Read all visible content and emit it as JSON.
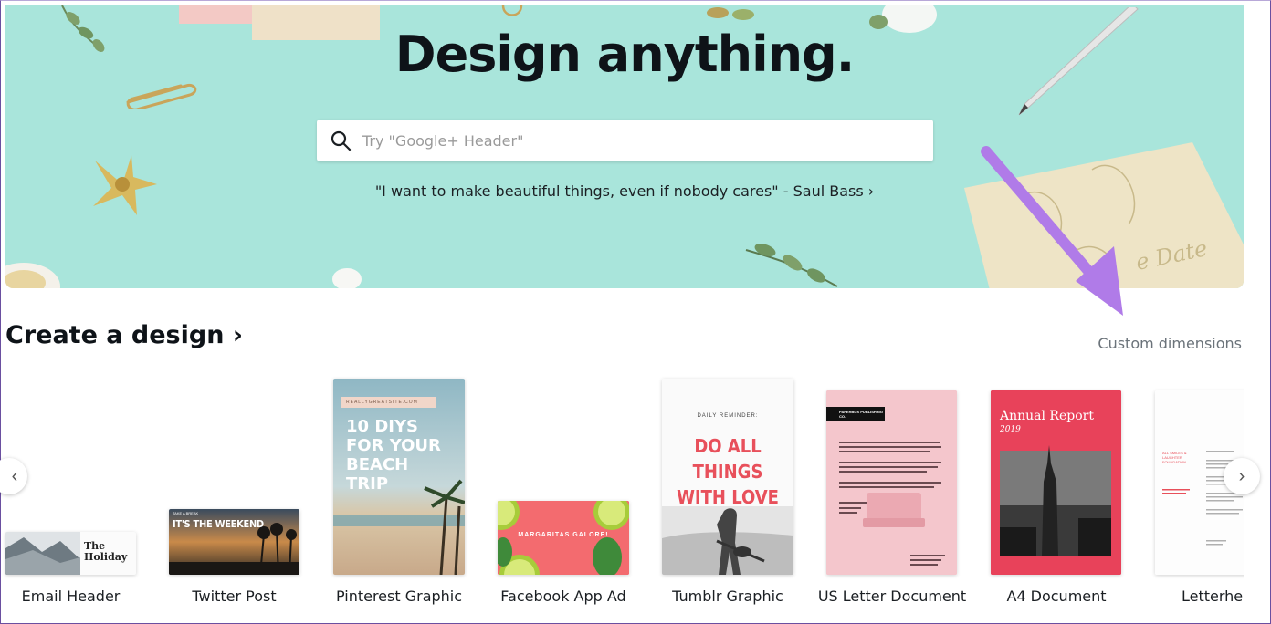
{
  "hero": {
    "title": "Design anything.",
    "search_placeholder": "Try \"Google+ Header\"",
    "quote": "\"I want to make beautiful things, even if nobody cares\" - Saul Bass ›",
    "background_color": "#a9e5db"
  },
  "section": {
    "title": "Create a design ›",
    "custom_dimensions": "Custom dimensions"
  },
  "cards": [
    {
      "label": "Email Header",
      "thumb_text": "The Holiday"
    },
    {
      "label": "Twitter Post",
      "thumb_text": "IT'S THE WEEKEND",
      "thumb_small": "TAKE A BREAK"
    },
    {
      "label": "Pinterest Graphic",
      "thumb_text": "10 DIYS FOR YOUR BEACH TRIP",
      "thumb_small": "REALLYGREATSITE.COM"
    },
    {
      "label": "Facebook App Ad",
      "thumb_text": "MARGARITAS GALORE!"
    },
    {
      "label": "Tumblr Graphic",
      "thumb_text": "DO ALL THINGS WITH LOVE",
      "thumb_small": "DAILY REMINDER:"
    },
    {
      "label": "US Letter Document",
      "thumb_text": "PAPERBOX PUBLISHING CO."
    },
    {
      "label": "A4 Document",
      "thumb_text": "Annual Report",
      "thumb_small": "2019"
    },
    {
      "label": "Letterhea",
      "thumb_text": "ALL SMILES & LAUGHTER FOUNDATION"
    }
  ],
  "nav": {
    "prev_icon": "chevron-left-icon",
    "next_icon": "chevron-right-icon"
  },
  "colors": {
    "arrow_annotation": "#b07be8",
    "tumblr_red": "#e8505b",
    "a4_red": "#e8425a",
    "us_letter_pink": "#f4c6cc"
  }
}
